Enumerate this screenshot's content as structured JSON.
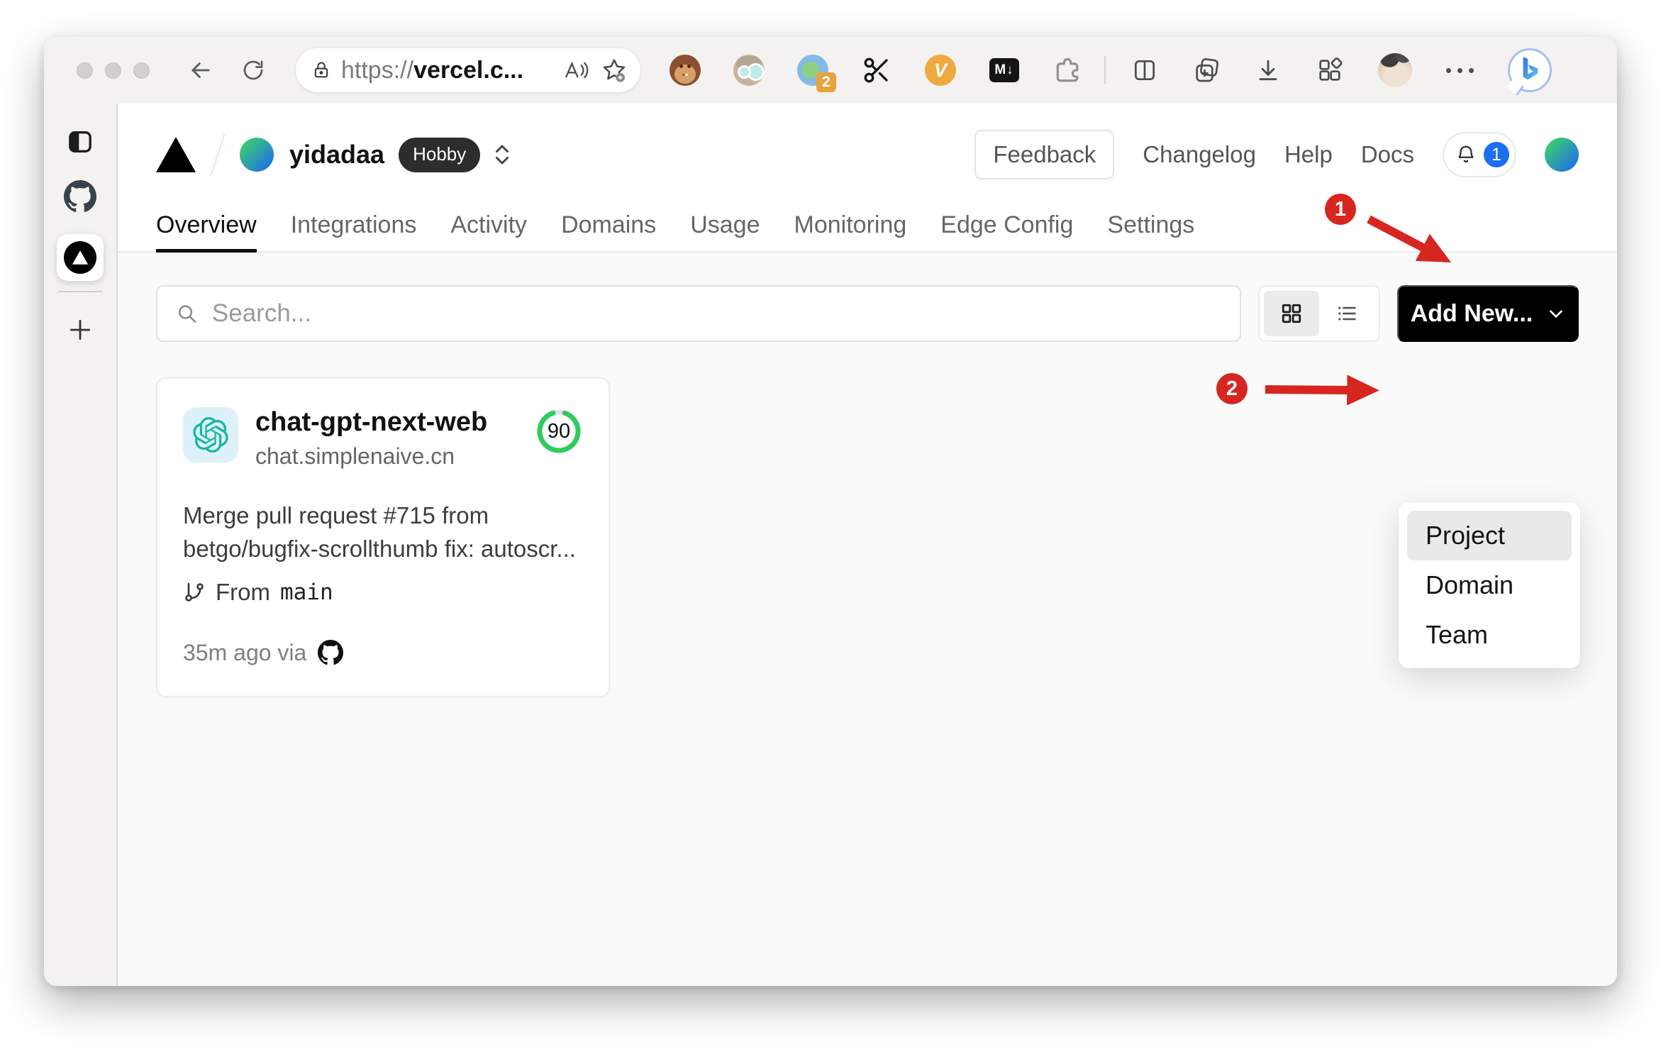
{
  "browser": {
    "url": {
      "scheme": "https://",
      "host": "vercel.c..."
    },
    "extensions": {
      "recorder_badge": "2",
      "vc_label": "V",
      "markdown_label": "M↓"
    }
  },
  "vercel": {
    "team": {
      "name": "yidadaa",
      "plan": "Hobby"
    },
    "header_links": {
      "feedback": "Feedback",
      "changelog": "Changelog",
      "help": "Help",
      "docs": "Docs"
    },
    "notification_count": "1",
    "tabs": [
      {
        "label": "Overview"
      },
      {
        "label": "Integrations"
      },
      {
        "label": "Activity"
      },
      {
        "label": "Domains"
      },
      {
        "label": "Usage"
      },
      {
        "label": "Monitoring"
      },
      {
        "label": "Edge Config"
      },
      {
        "label": "Settings"
      }
    ],
    "search_placeholder": "Search...",
    "add_new_label": "Add New...",
    "menu": {
      "items": [
        {
          "label": "Project"
        },
        {
          "label": "Domain"
        },
        {
          "label": "Team"
        }
      ],
      "highlighted": "Project"
    },
    "project": {
      "name": "chat-gpt-next-web",
      "domain": "chat.simplenaive.cn",
      "score": "90",
      "commit_message": "Merge pull request #715 from betgo/bugfix-scrollthumb fix: autoscr...",
      "branch_label": "From",
      "branch_name": "main",
      "time": "35m ago via"
    },
    "annotations": {
      "step1": "1",
      "step2": "2"
    }
  },
  "colors": {
    "annotation_red": "#d7261f",
    "score_green": "#2ecc5e",
    "notification_blue": "#1c6ef3",
    "openai_teal": "#17b8a0"
  }
}
